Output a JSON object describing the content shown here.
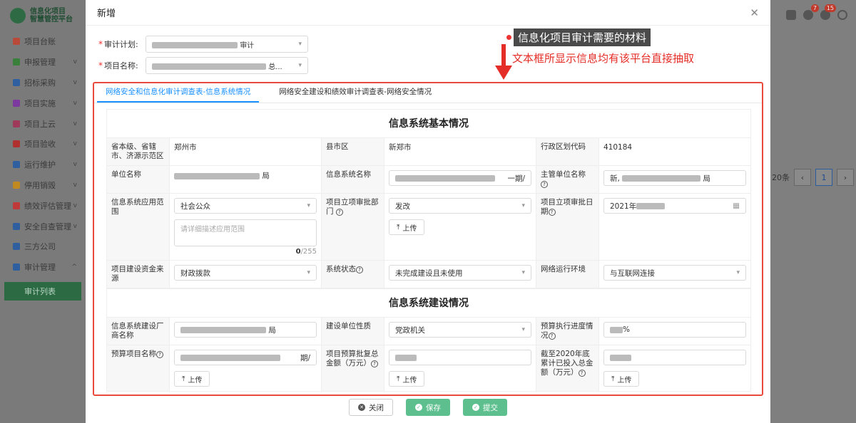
{
  "app": {
    "logo_text_line1": "信息化项目",
    "logo_text_line2": "智慧管控平台",
    "badges": {
      "bell": "7",
      "help": "15"
    }
  },
  "sidebar": {
    "items": [
      {
        "label": "项目台账",
        "icon_color": "#b94a3a"
      },
      {
        "label": "申报管理",
        "icon_color": "#3a7f3a"
      },
      {
        "label": "招标采购",
        "icon_color": "#2f5f9e"
      },
      {
        "label": "项目实施",
        "icon_color": "#7d3a9e"
      },
      {
        "label": "项目上云",
        "icon_color": "#9e3a5a"
      },
      {
        "label": "项目验收",
        "icon_color": "#b03030"
      },
      {
        "label": "运行维护",
        "icon_color": "#2f5f9e"
      },
      {
        "label": "停用销毁",
        "icon_color": "#c08a20"
      },
      {
        "label": "绩效评估管理",
        "icon_color": "#c03a3a"
      },
      {
        "label": "安全自查管理",
        "icon_color": "#2f5f9e"
      },
      {
        "label": "三方公司",
        "icon_color": "#2f5f9e"
      },
      {
        "label": "审计管理",
        "icon_color": "#2f5f9e"
      }
    ],
    "sub_item": "审计列表"
  },
  "background": {
    "page_size_label": "20条",
    "current_page": "1"
  },
  "modal": {
    "title": "新增",
    "audit_plan_label": "审计计划:",
    "audit_plan_value_tail": "审计",
    "project_name_label": "项目名称:",
    "project_name_value_tail": "总...",
    "annotation_title": "信息化项目审计需要的材料",
    "annotation_note": "文本框所显示信息均有该平台直接抽取",
    "tabs": [
      "网络安全和信息化审计调查表-信息系统情况",
      "网络安全建设和绩效审计调查表-网络安全情况"
    ],
    "section1_title": "信息系统基本情况",
    "section2_title": "信息系统建设情况",
    "fields": {
      "province_label": "省本级、省辖市、济源示范区",
      "province_value": "郑州市",
      "county_label": "县市区",
      "county_value": "新郑市",
      "region_code_label": "行政区划代码",
      "region_code_value": "410184",
      "unit_name_label": "单位名称",
      "unit_name_tail": "局",
      "system_name_label": "信息系统名称",
      "system_name_tail": "一期/",
      "supervisor_label": "主管单位名称",
      "supervisor_head": "新,",
      "supervisor_tail": "局",
      "scope_label": "信息系统应用范围",
      "scope_value": "社会公众",
      "scope_placeholder": "请详细描述应用范围",
      "scope_count": "0",
      "scope_max": "/255",
      "approval_dept_label": "项目立项审批部门",
      "approval_dept_value": "发改",
      "approval_date_label": "项目立项审批日期",
      "approval_date_value": "2021年",
      "fund_source_label": "项目建设资金来源",
      "fund_source_value": "财政拨款",
      "system_status_label": "系统状态",
      "system_status_value": "未完成建设且未使用",
      "network_env_label": "网络运行环境",
      "network_env_value": "与互联网连接",
      "vendor_label": "信息系统建设厂商名称",
      "vendor_tail": "局",
      "unit_nature_label": "建设单位性质",
      "unit_nature_value": "党政机关",
      "budget_progress_label": "预算执行进度情况",
      "budget_progress_tail": "%",
      "budget_project_label": "预算项目名称",
      "budget_project_tail": "期/",
      "approved_total_label": "项目预算批复总金额（万元）",
      "invested_total_label": "截至2020年底累计已投入总金额（万元）",
      "upload_label": "上传"
    },
    "buttons": {
      "close": "关闭",
      "save": "保存",
      "submit": "提交"
    }
  }
}
